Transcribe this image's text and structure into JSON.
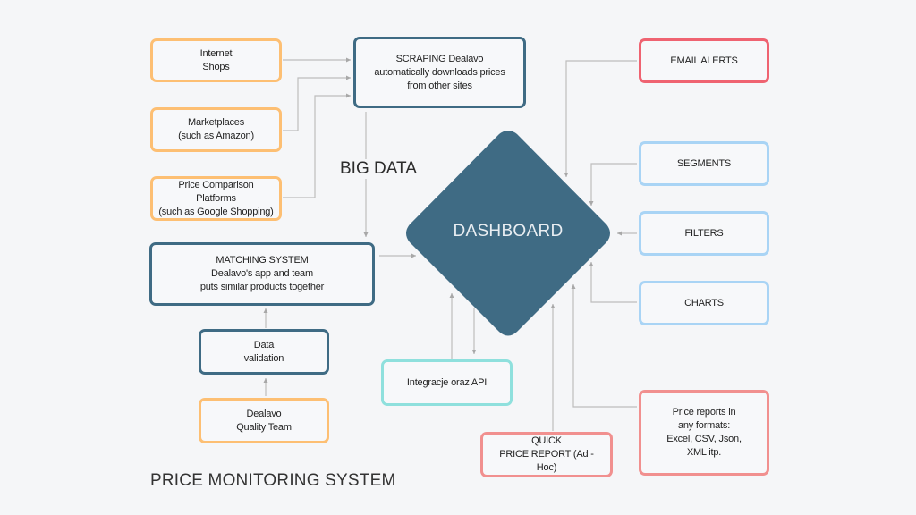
{
  "title": "PRICE MONITORING SYSTEM",
  "big_data_label": "BIG DATA",
  "center": {
    "label": "DASHBOARD",
    "color": "#3f6b84"
  },
  "colors": {
    "source_border": "#fdbf73",
    "process_border": "#3f6b84",
    "alert_border": "#ef6371",
    "report_border": "#f1908f",
    "feature_border": "#a9d4f5",
    "api_border": "#8fe0dd",
    "connector": "#b8b8b8",
    "background": "#f5f6f8"
  },
  "sources": [
    {
      "label": "Internet\nShops"
    },
    {
      "label": "Marketplaces\n(such as Amazon)"
    },
    {
      "label": "Price Comparison Platforms\n(such as Google Shopping)"
    }
  ],
  "scraping": {
    "label": "SCRAPING Dealavo\nautomatically downloads prices\nfrom other sites"
  },
  "matching": {
    "label": "MATCHING SYSTEM\nDealavo's app and team\nputs similar products together"
  },
  "validation": {
    "label": "Data\nvalidation"
  },
  "quality_team": {
    "label": "Dealavo\nQuality Team"
  },
  "integration": {
    "label": "Integracje oraz API"
  },
  "quick_report": {
    "label": "QUICK\nPRICE REPORT (Ad - Hoc)"
  },
  "price_reports": {
    "label": "Price reports in\nany formats:\nExcel, CSV, Json,\nXML itp."
  },
  "features": [
    {
      "label": "EMAIL ALERTS"
    },
    {
      "label": "SEGMENTS"
    },
    {
      "label": "FILTERS"
    },
    {
      "label": "CHARTS"
    }
  ]
}
